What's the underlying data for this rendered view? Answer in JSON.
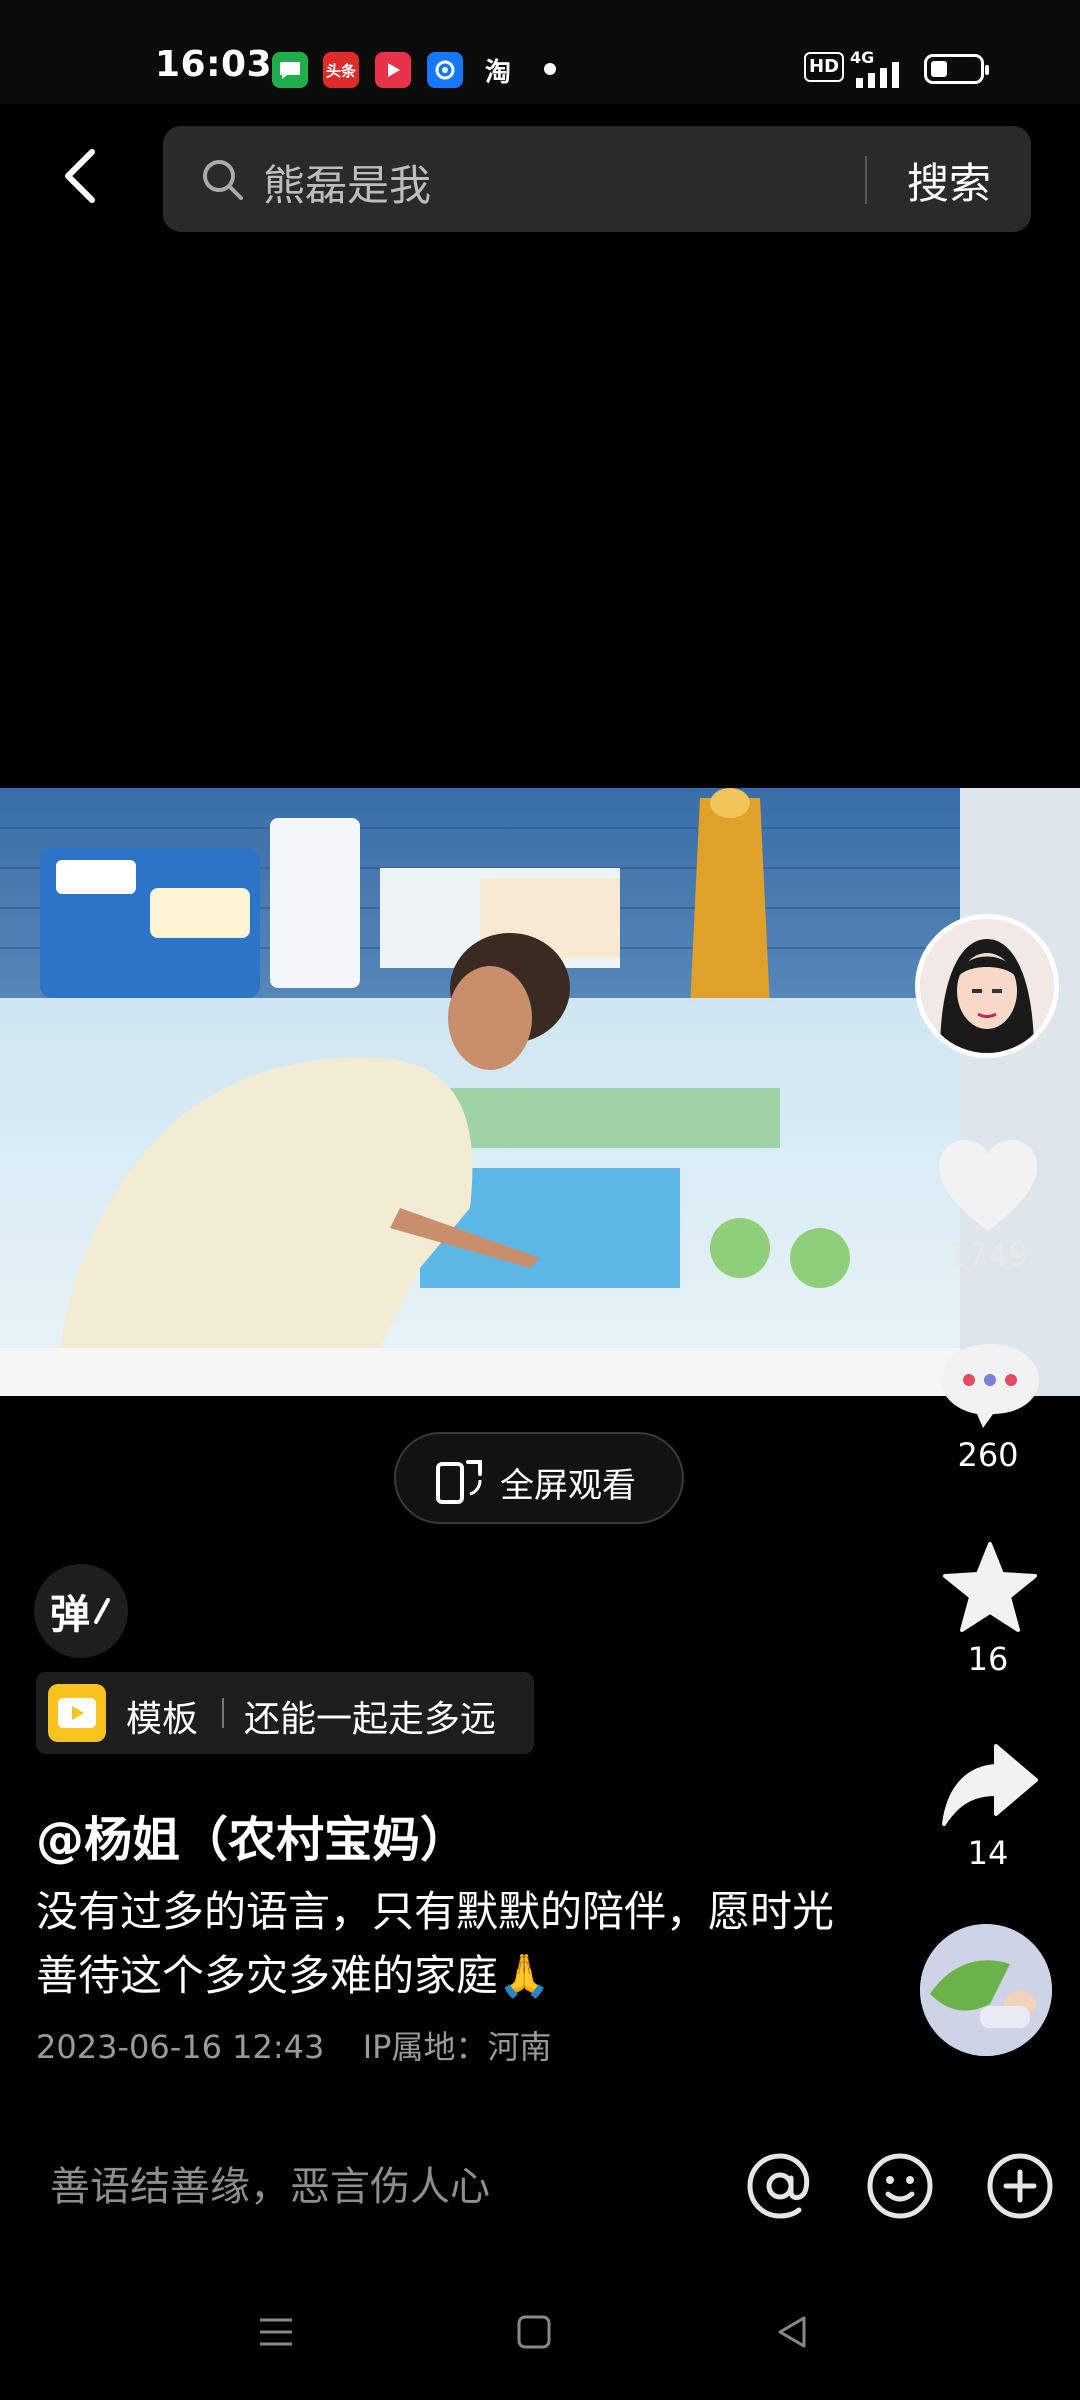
{
  "status_bar": {
    "time": "16:03",
    "notif_toutiao": "头条",
    "notif_taobao": "淘",
    "hd": "HD",
    "network": "4G",
    "battery_level": 0.35
  },
  "search": {
    "query": "熊磊是我",
    "button_label": "搜索"
  },
  "video": {
    "fullscreen_label": "全屏观看"
  },
  "actions": {
    "likes": "1749",
    "comments": "260",
    "favorites": "16",
    "shares": "14"
  },
  "danmu_label": "弹",
  "template": {
    "label": "模板",
    "song": "还能一起走多远"
  },
  "post": {
    "author": "@杨姐（农村宝妈）",
    "caption": "没有过多的语言，只有默默的陪伴，愿时光善待这个多灾多难的家庭🙏",
    "date": "2023-06-16 12:43",
    "location": "IP属地：河南"
  },
  "comment_bar": {
    "placeholder": "善语结善缘，恶言伤人心"
  },
  "colors": {
    "background": "#000000",
    "search_bg": "#2a2a2a",
    "template_icon": "#f8c31d",
    "muted_text": "#9a9a9a"
  }
}
